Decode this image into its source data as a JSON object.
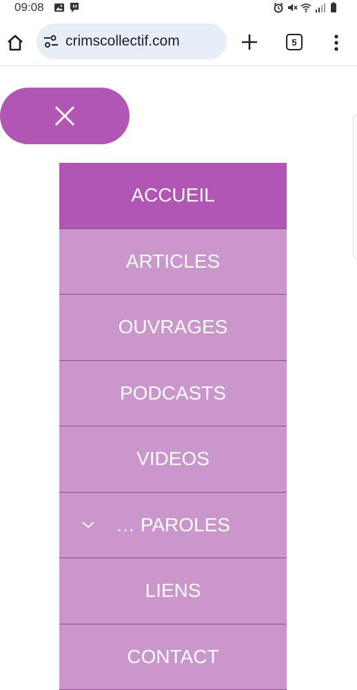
{
  "status_bar": {
    "time": "09:08",
    "left_icons": [
      "image-icon",
      "chat-icon"
    ],
    "right_icons": [
      "alarm-icon",
      "mute-icon",
      "wifi-icon",
      "signal-icon",
      "battery-icon"
    ]
  },
  "browser": {
    "url": "crimscollectif.com",
    "tab_count": "5",
    "icons": [
      "home-icon",
      "site-settings-icon",
      "plus-icon",
      "more-vert-icon"
    ]
  },
  "page": {
    "close_icon": "close-icon",
    "menu": [
      {
        "label": "ACCUEIL",
        "active": true
      },
      {
        "label": "ARTICLES",
        "active": false
      },
      {
        "label": "OUVRAGES",
        "active": false
      },
      {
        "label": "PODCASTS",
        "active": false
      },
      {
        "label": "VIDEOS",
        "active": false
      },
      {
        "label": "… PAROLES",
        "active": false,
        "has_submenu": true
      },
      {
        "label": "LIENS",
        "active": false
      },
      {
        "label": "CONTACT",
        "active": false
      }
    ]
  },
  "colors": {
    "accent": "#b256b5",
    "menu_bg": "#cb96cc",
    "divider": "#8a4c8c"
  }
}
